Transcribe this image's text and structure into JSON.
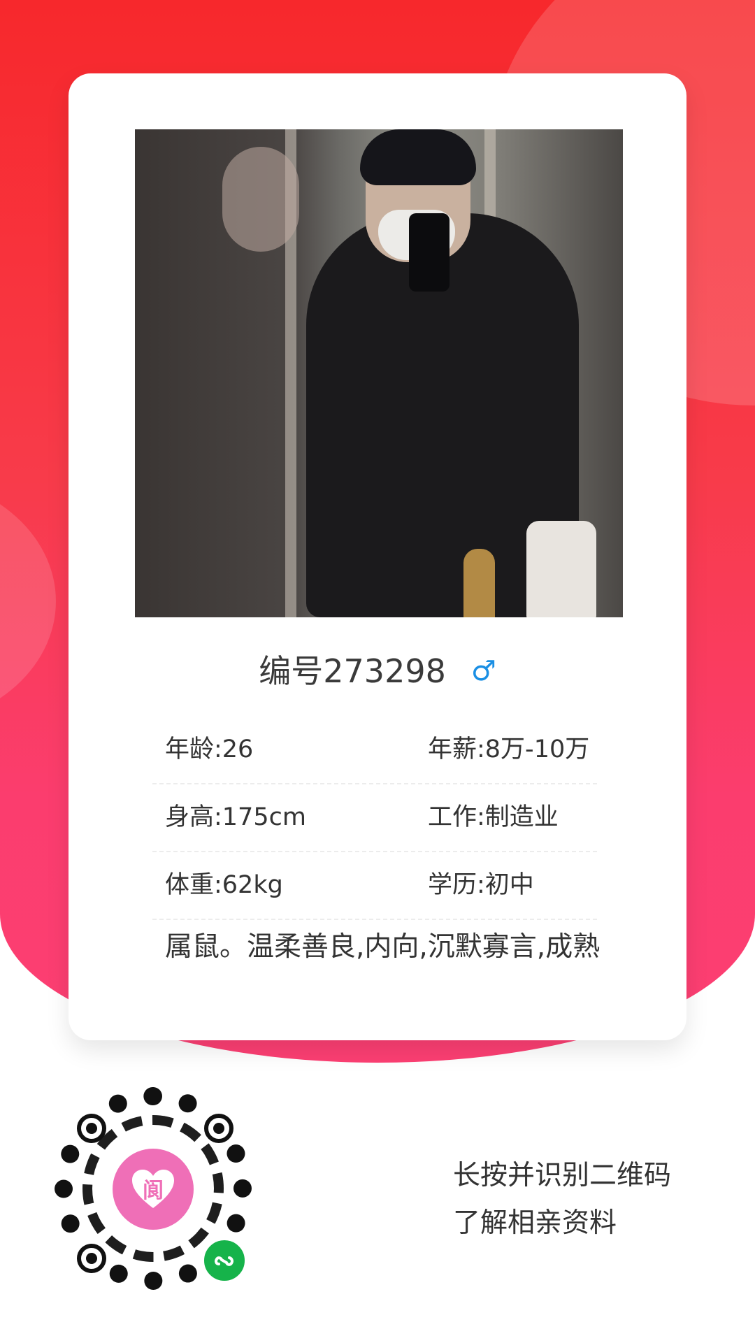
{
  "profile": {
    "title": "编号273298",
    "gender_symbol": "♂",
    "info": [
      {
        "left": "年龄:26",
        "right": "年薪:8万-10万"
      },
      {
        "left": "身高:175cm",
        "right": "工作:制造业"
      },
      {
        "left": "体重:62kg",
        "right": "学历:初中"
      }
    ],
    "description": "属鼠。温柔善良,内向,沉默寡言,成熟"
  },
  "qr": {
    "logo_char": "阆",
    "badge_icon": "mini-program-icon"
  },
  "cta": {
    "line1": "长按并识别二维码",
    "line2": "了解相亲资料"
  },
  "colors": {
    "hero_top": "#f7282c",
    "hero_bottom": "#fc3f73",
    "gender_blue": "#1a8fe4",
    "logo_pink": "#ef6fb7",
    "badge_green": "#16b34a"
  }
}
